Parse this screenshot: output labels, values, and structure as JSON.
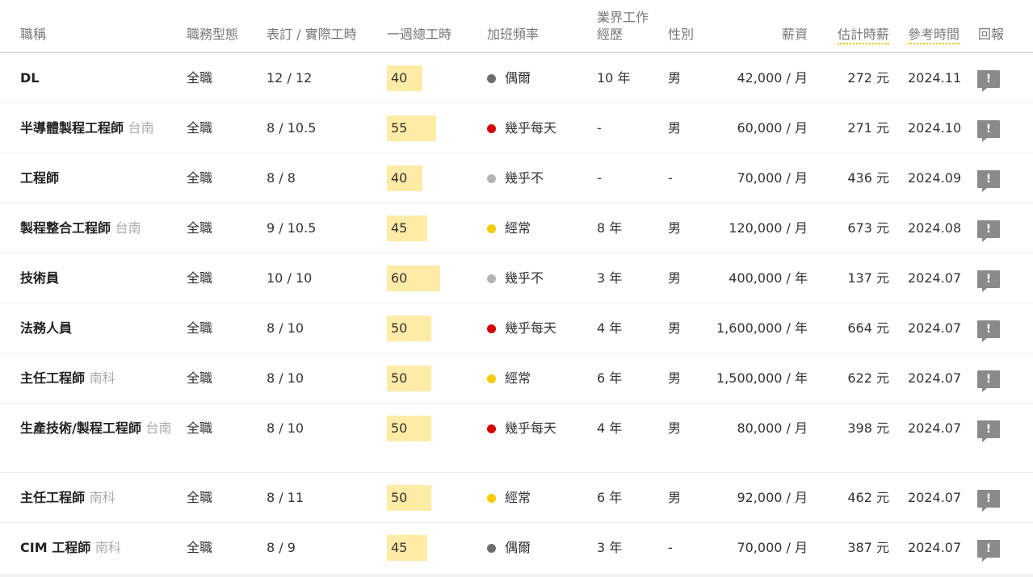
{
  "headers": {
    "title": "職稱",
    "type": "職務型態",
    "hours": "表訂 / 實際工時",
    "weekly": "一週總工時",
    "overtime": "加班頻率",
    "experience_line1": "業界工作",
    "experience_line2": "經歷",
    "gender": "性別",
    "salary": "薪資",
    "hourly": "估計時薪",
    "ref_time": "參考時間",
    "report": "回報"
  },
  "colors": {
    "occasionally": "#6e6e6e",
    "almost_every_day": "#d40000",
    "almost_never": "#b4b4b4",
    "often": "#f5cc00",
    "hours_highlight": "#fdeba6"
  },
  "rows": [
    {
      "title": "DL",
      "location": "",
      "type": "全職",
      "hours": "12 / 12",
      "weekly": "40",
      "overtime": "偶爾",
      "overtime_color": "#6e6e6e",
      "experience": "10 年",
      "gender": "男",
      "salary": "42,000 / 月",
      "hourly": "272 元",
      "ref_time": "2024.11",
      "report_icon": "!"
    },
    {
      "title": "半導體製程工程師",
      "location": "台南",
      "type": "全職",
      "hours": "8 / 10.5",
      "weekly": "55",
      "overtime": "幾乎每天",
      "overtime_color": "#d40000",
      "experience": "-",
      "gender": "男",
      "salary": "60,000 / 月",
      "hourly": "271 元",
      "ref_time": "2024.10",
      "report_icon": "!"
    },
    {
      "title": "工程師",
      "location": "",
      "type": "全職",
      "hours": "8 / 8",
      "weekly": "40",
      "overtime": "幾乎不",
      "overtime_color": "#b4b4b4",
      "experience": "-",
      "gender": "-",
      "salary": "70,000 / 月",
      "hourly": "436 元",
      "ref_time": "2024.09",
      "report_icon": "!"
    },
    {
      "title": "製程整合工程師",
      "location": "台南",
      "type": "全職",
      "hours": "9 / 10.5",
      "weekly": "45",
      "overtime": "經常",
      "overtime_color": "#f5cc00",
      "experience": "8 年",
      "gender": "男",
      "salary": "120,000 / 月",
      "hourly": "673 元",
      "ref_time": "2024.08",
      "report_icon": "!"
    },
    {
      "title": "技術員",
      "location": "",
      "type": "全職",
      "hours": "10 / 10",
      "weekly": "60",
      "overtime": "幾乎不",
      "overtime_color": "#b4b4b4",
      "experience": "3 年",
      "gender": "男",
      "salary": "400,000 / 年",
      "hourly": "137 元",
      "ref_time": "2024.07",
      "report_icon": "!"
    },
    {
      "title": "法務人員",
      "location": "",
      "type": "全職",
      "hours": "8 / 10",
      "weekly": "50",
      "overtime": "幾乎每天",
      "overtime_color": "#d40000",
      "experience": "4 年",
      "gender": "男",
      "salary": "1,600,000 / 年",
      "hourly": "664 元",
      "ref_time": "2024.07",
      "report_icon": "!"
    },
    {
      "title": "主任工程師",
      "location": "南科",
      "type": "全職",
      "hours": "8 / 10",
      "weekly": "50",
      "overtime": "經常",
      "overtime_color": "#f5cc00",
      "experience": "6 年",
      "gender": "男",
      "salary": "1,500,000 / 年",
      "hourly": "622 元",
      "ref_time": "2024.07",
      "report_icon": "!"
    },
    {
      "title": "生產技術/製程工程師",
      "location": "台南",
      "type": "全職",
      "hours": "8 / 10",
      "weekly": "50",
      "overtime": "幾乎每天",
      "overtime_color": "#d40000",
      "experience": "4 年",
      "gender": "男",
      "salary": "80,000 / 月",
      "hourly": "398 元",
      "ref_time": "2024.07",
      "report_icon": "!"
    },
    {
      "title": "主任工程師",
      "location": "南科",
      "type": "全職",
      "hours": "8 / 11",
      "weekly": "50",
      "overtime": "經常",
      "overtime_color": "#f5cc00",
      "experience": "6 年",
      "gender": "男",
      "salary": "92,000 / 月",
      "hourly": "462 元",
      "ref_time": "2024.07",
      "report_icon": "!"
    },
    {
      "title": "CIM 工程師",
      "location": "南科",
      "type": "全職",
      "hours": "8 / 9",
      "weekly": "45",
      "overtime": "偶爾",
      "overtime_color": "#6e6e6e",
      "experience": "3 年",
      "gender": "-",
      "salary": "70,000 / 月",
      "hourly": "387 元",
      "ref_time": "2024.07",
      "report_icon": "!"
    }
  ]
}
